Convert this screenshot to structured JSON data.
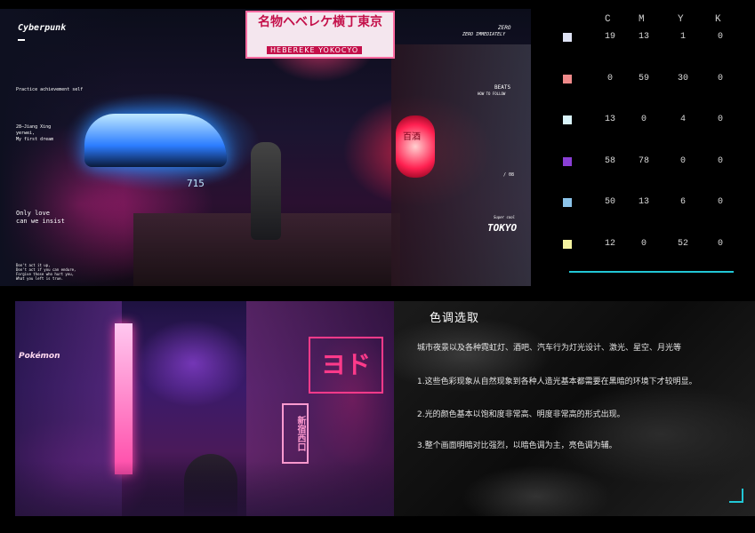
{
  "poster_top": {
    "brand": "Cyberpunk",
    "tagline": "Practice achievement self",
    "credit_lines": [
      "28—Jiang Xing",
      "yerwei,",
      "My first dream"
    ],
    "quote": [
      "Only love",
      "can we insist"
    ],
    "small_print": [
      "Don't act it up,",
      "Don't act if you can endure,",
      "Forgive those who hurt you,",
      "What you left is true."
    ],
    "sign_main": "名物ヘベレケ横丁東京",
    "sign_sub": "HEBEREKE YOKOCYO",
    "zero": [
      "ZERO",
      "ZERO IMMEDIATELY"
    ],
    "beats": [
      "BEATS",
      "HOW TO FOLLOW"
    ],
    "tokyo": [
      "Super cool",
      "TOKYO"
    ],
    "shop_sign": "百酒",
    "page_no": "/ 08",
    "car_no": "715"
  },
  "cmyk_table": {
    "headers": [
      "C",
      "M",
      "Y",
      "K"
    ],
    "rows": [
      {
        "color": "#dfe3f5",
        "values": [
          "19",
          "13",
          "1",
          "0"
        ]
      },
      {
        "color": "#f08a8a",
        "values": [
          "0",
          "59",
          "30",
          "0"
        ]
      },
      {
        "color": "#d9f4fa",
        "values": [
          "13",
          "0",
          "4",
          "0"
        ]
      },
      {
        "color": "#8a3fd6",
        "values": [
          "58",
          "78",
          "0",
          "0"
        ]
      },
      {
        "color": "#8cc4ea",
        "values": [
          "50",
          "13",
          "6",
          "0"
        ]
      },
      {
        "color": "#f4f3a0",
        "values": [
          "12",
          "0",
          "52",
          "0"
        ]
      }
    ],
    "accent": "#22c7d6"
  },
  "poster_bottom": {
    "signs": [
      "ヨド",
      "新宿西口",
      "Pokémon"
    ]
  },
  "info": {
    "title": "色调选取",
    "lines": [
      "城市夜景以及各种霓虹灯、酒吧、汽车行为灯光设计、激光、星空、月光等",
      "1.这些色彩现象从自然现象到各种人造光基本都需要在黑暗的环境下才较明显。",
      "2.光的颜色基本以饱和度非常高、明度非常高的形式出现。",
      "3.整个画面明暗对比强烈，以暗色调为主，亮色调为辅。"
    ]
  }
}
